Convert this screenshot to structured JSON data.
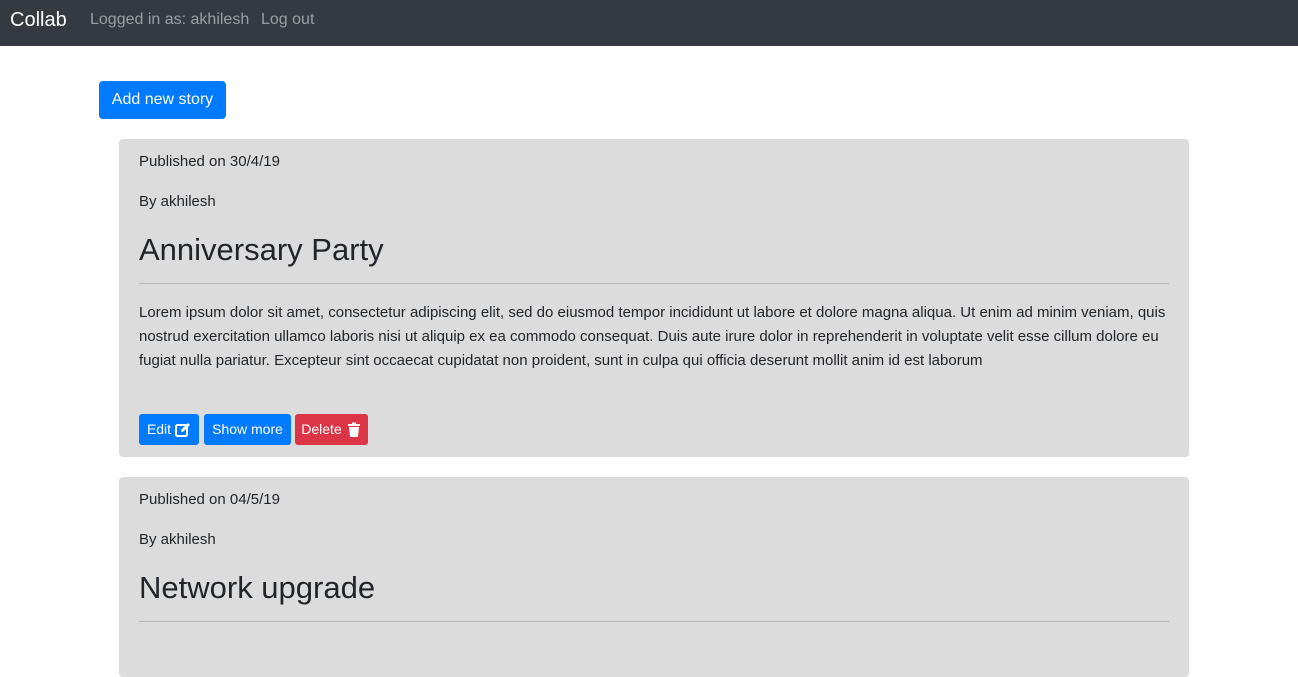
{
  "navbar": {
    "brand": "Collab",
    "logged_in_text": "Logged in as: akhilesh",
    "logout_label": "Log out"
  },
  "actions": {
    "add_story_label": "Add new story"
  },
  "stories": [
    {
      "published": "Published on 30/4/19",
      "author": "By akhilesh",
      "title": "Anniversary Party",
      "body": "Lorem ipsum dolor sit amet, consectetur adipiscing elit, sed do eiusmod tempor incididunt ut labore et dolore magna aliqua. Ut enim ad minim veniam, quis nostrud exercitation ullamco laboris nisi ut aliquip ex ea commodo consequat. Duis aute irure dolor in reprehenderit in voluptate velit esse cillum dolore eu fugiat nulla pariatur. Excepteur sint occaecat cupidatat non proident, sunt in culpa qui officia deserunt mollit anim id est laborum",
      "edit_label": "Edit",
      "show_more_label": "Show more",
      "delete_label": "Delete",
      "edit_icon": "edit-icon",
      "delete_icon": "trash-icon"
    },
    {
      "published": "Published on 04/5/19",
      "author": "By akhilesh",
      "title": "Network upgrade"
    }
  ],
  "colors": {
    "navbar_bg": "#343a40",
    "primary": "#007bff",
    "danger": "#dc3545",
    "card_bg": "#dcdcdc"
  }
}
